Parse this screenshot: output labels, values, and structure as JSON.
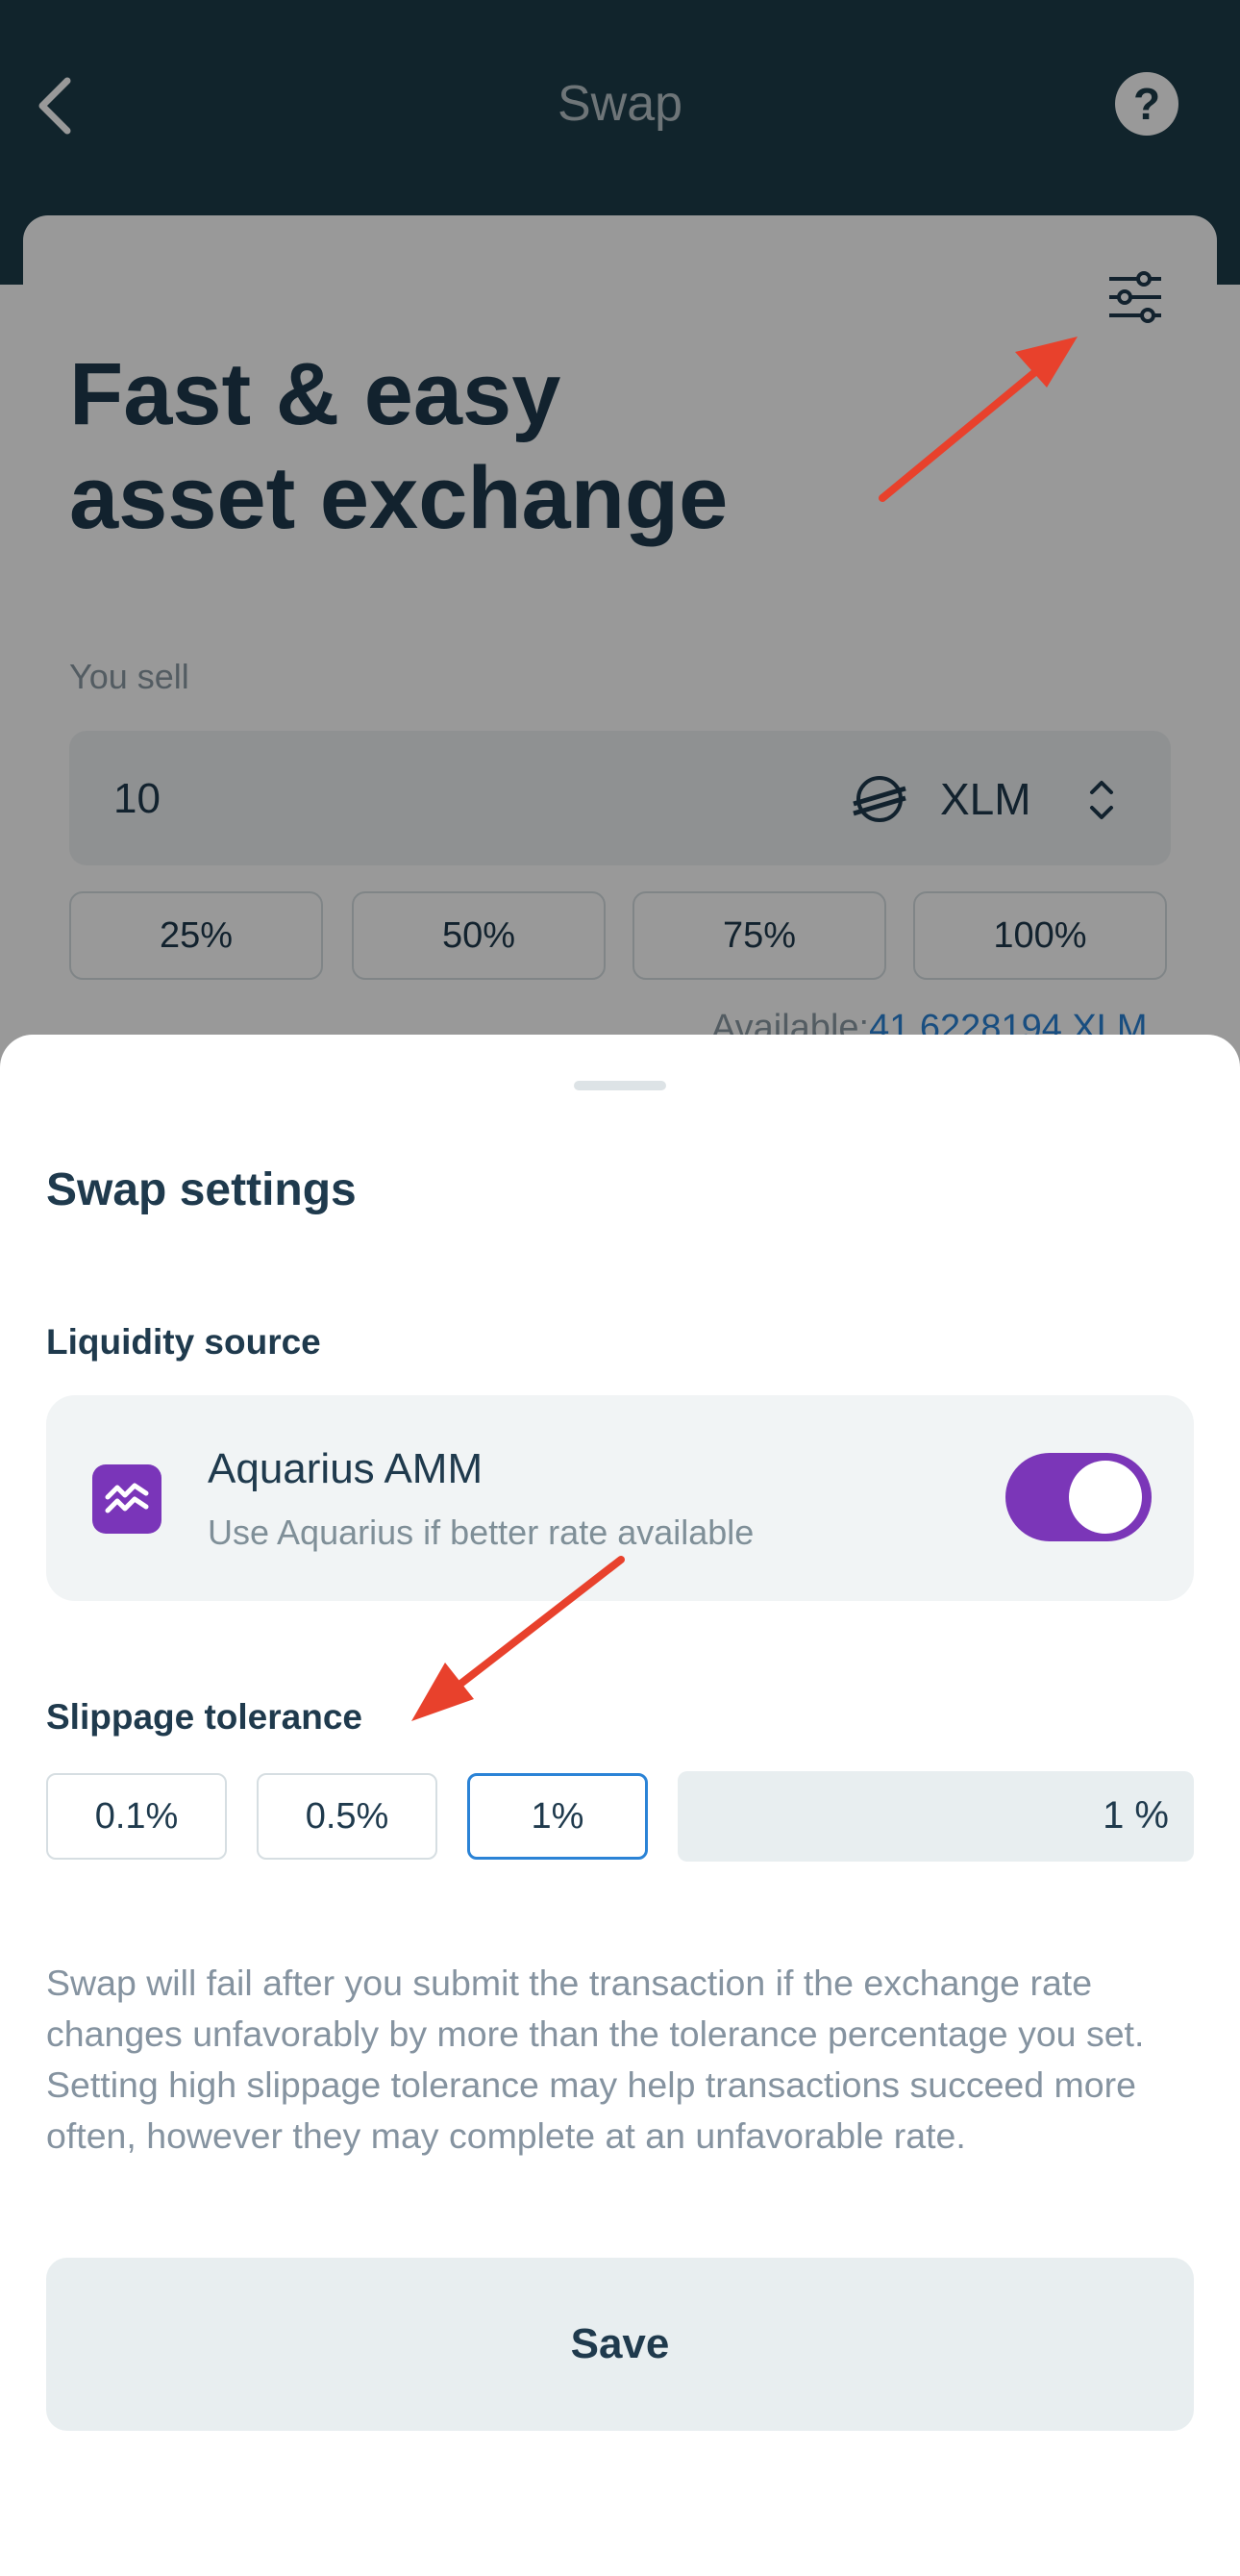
{
  "header": {
    "title": "Swap",
    "help_icon": "?"
  },
  "hero": {
    "line1": "Fast & easy",
    "line2": "asset exchange"
  },
  "sell": {
    "label": "You sell",
    "amount": "10",
    "asset": "XLM",
    "percent_options": [
      "25%",
      "50%",
      "75%",
      "100%"
    ],
    "available_label": "Available:",
    "available_amount": "41.6228194 XLM"
  },
  "sheet": {
    "title": "Swap settings",
    "liquidity_label": "Liquidity source",
    "aquarius": {
      "name": "Aquarius AMM",
      "description": "Use Aquarius if better rate available",
      "enabled": true
    },
    "slippage_label": "Slippage tolerance",
    "slippage_options": [
      "0.1%",
      "0.5%",
      "1%"
    ],
    "slippage_selected": "1%",
    "slippage_custom": "1 %",
    "description": "Swap will fail after you submit the transaction if the exchange rate changes unfavorably by more than the tolerance percentage you set. Setting high slippage tolerance may help transactions succeed more often, however they may complete at an unfavorable rate.",
    "save_label": "Save"
  },
  "colors": {
    "header_bg": "#1d3c4a",
    "accent_purple": "#7b36b8",
    "selected_border": "#2b83d6",
    "annotation_arrow": "#e8412c"
  }
}
